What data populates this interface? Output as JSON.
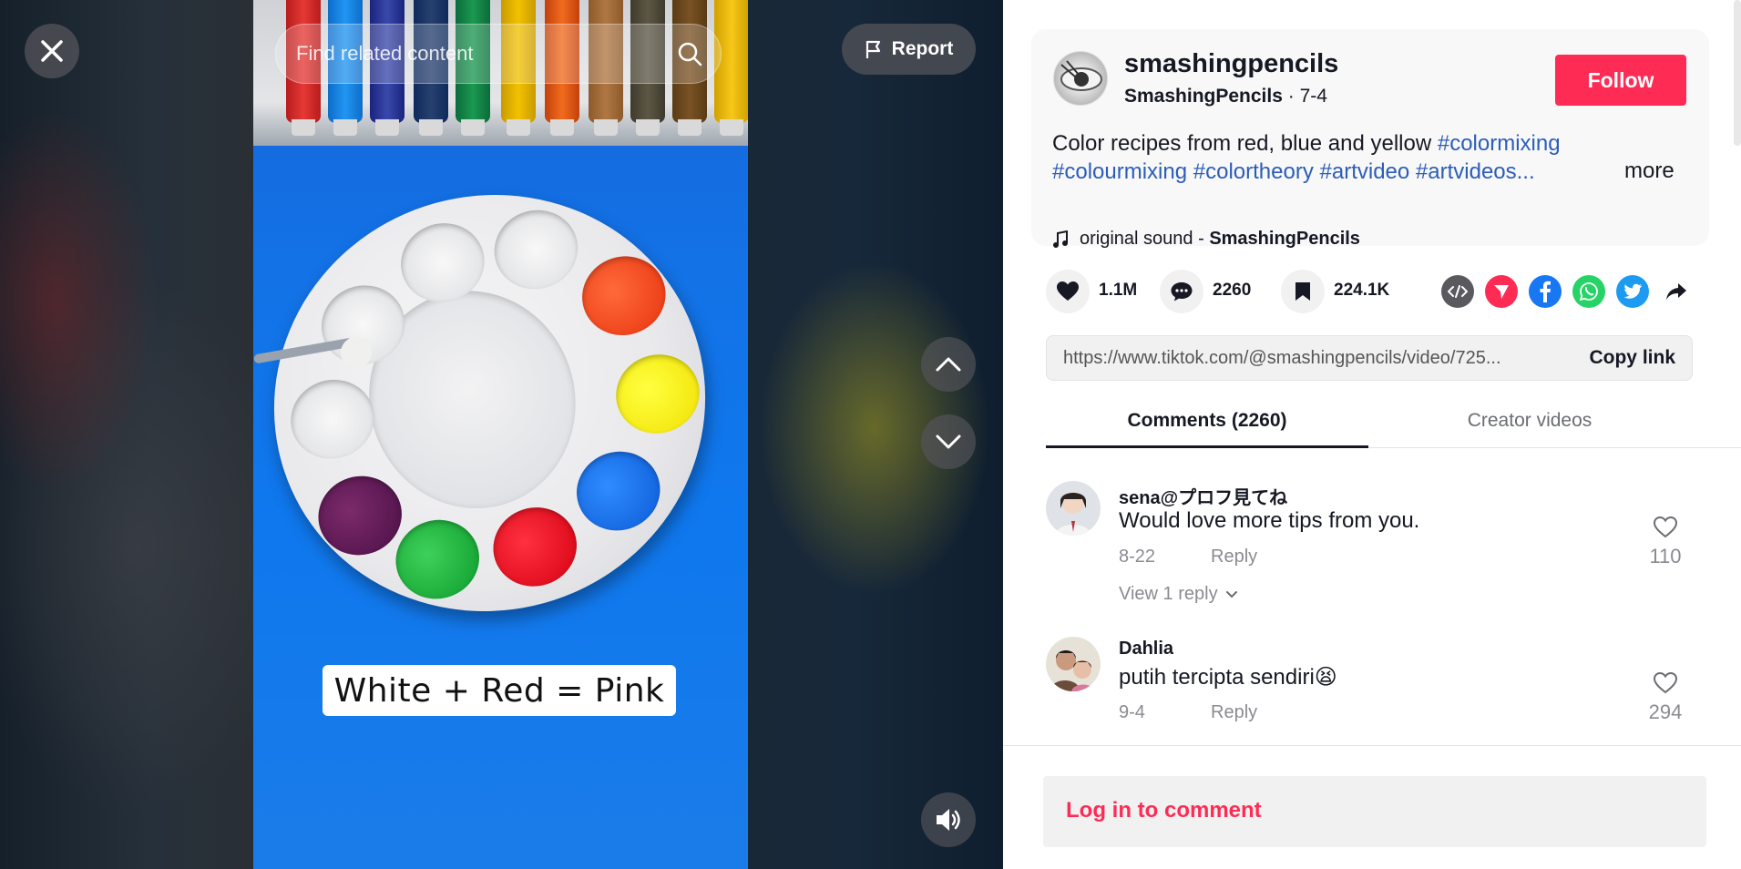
{
  "video": {
    "search_placeholder": "Find related content",
    "report_label": "Report",
    "caption": "White + Red = Pink"
  },
  "author": {
    "username": "smashingpencils",
    "display_name": "SmashingPencils",
    "date": "7-4",
    "follow_label": "Follow"
  },
  "description": {
    "text": "Color recipes from red, blue and yellow ",
    "hashtags": [
      "#colormixing",
      "#colourmixing",
      "#colortheory",
      "#artvideo",
      "#artvideos..."
    ],
    "more_label": "more"
  },
  "sound": {
    "prefix": "original sound - ",
    "artist": "SmashingPencils"
  },
  "stats": {
    "likes": "1.1M",
    "comments": "2260",
    "saves": "224.1K"
  },
  "share": {
    "icons": [
      "embed-icon",
      "send-icon",
      "facebook-icon",
      "whatsapp-icon",
      "twitter-icon",
      "share-arrow-icon"
    ],
    "colors": {
      "embed": "#5a5a5e",
      "send": "#fe2c55",
      "facebook": "#1877f2",
      "whatsapp": "#25d366",
      "twitter": "#1d9bf0"
    }
  },
  "link": {
    "url": "https://www.tiktok.com/@smashingpencils/video/725...",
    "copy_label": "Copy link"
  },
  "tabs": {
    "comments": "Comments (2260)",
    "creator": "Creator videos"
  },
  "comments": [
    {
      "name": "sena@プロフ見てね",
      "text": "Would love more tips from you.",
      "date": "8-22",
      "reply_label": "Reply",
      "likes": "110",
      "view_replies": "View 1 reply"
    },
    {
      "name": "Dahlia",
      "text": "putih tercipta sendiri😫",
      "date": "9-4",
      "reply_label": "Reply",
      "likes": "294"
    }
  ],
  "login": {
    "label": "Log in to comment"
  },
  "colors": {
    "accent": "#fe2c55",
    "hashtag": "#2b5db9",
    "text": "#161823",
    "muted": "#8a8b91"
  }
}
